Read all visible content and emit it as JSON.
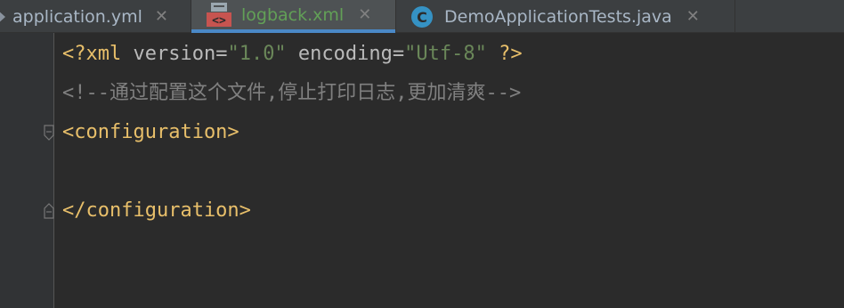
{
  "tabs": [
    {
      "label": "application.yml",
      "icon": "yml-file-icon",
      "active": false,
      "close": "✕"
    },
    {
      "label": "logback.xml",
      "icon": "xml-file-icon",
      "active": true,
      "close": "✕"
    },
    {
      "label": "DemoApplicationTests.java",
      "icon": "class-file-icon",
      "active": false,
      "close": "✕"
    }
  ],
  "editor": {
    "line1": {
      "open": "<?xml",
      "attr1": " version",
      "eq1": "=",
      "val1": "\"1.0\"",
      "attr2": " encoding",
      "eq2": "=",
      "val2": "\"Utf-8\"",
      "close": " ?>"
    },
    "line2": "<!--通过配置这个文件,停止打印日志,更加清爽-->",
    "line3": "<configuration>",
    "line5": "</configuration>"
  },
  "colors": {
    "background": "#2b2b2b",
    "tab_active_underline": "#4a88c7",
    "active_tab_text": "#62a057",
    "xml_tag": "#e8bf6a",
    "xml_value": "#6a8759",
    "comment": "#808080"
  }
}
